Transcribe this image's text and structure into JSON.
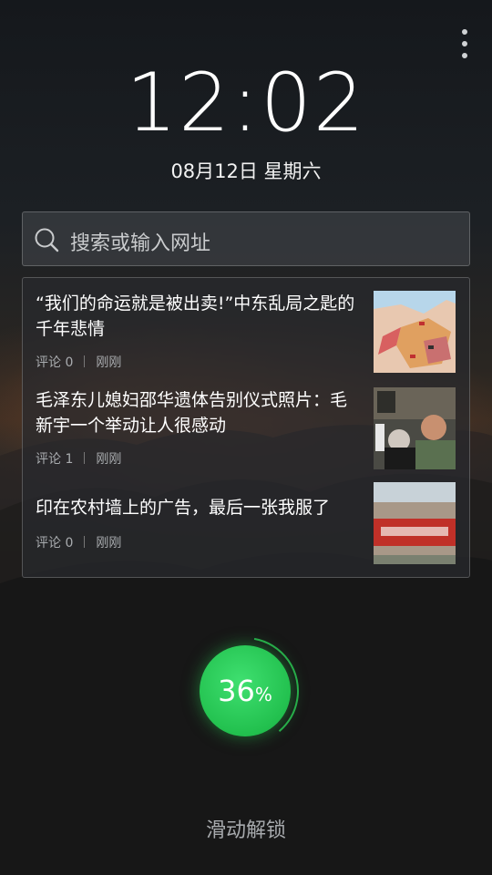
{
  "lockscreen": {
    "time": "12:02",
    "date": "08月12日 星期六",
    "menu_icon": "more-vert-icon",
    "search": {
      "placeholder": "搜索或输入网址",
      "icon": "search-icon"
    },
    "news": [
      {
        "title": "“我们的命运就是被出卖!”中东乱局之匙的千年悲情",
        "comment_label": "评论 0",
        "time": "刚刚",
        "thumb": "middle-east-map"
      },
      {
        "title": "毛泽东儿媳妇邵华遗体告别仪式照片：毛新宇一个举动让人很感动",
        "comment_label": "评论 1",
        "time": "刚刚",
        "thumb": "memorial-photo"
      },
      {
        "title": "印在农村墙上的广告，最后一张我服了",
        "comment_label": "评论 0",
        "time": "刚刚",
        "thumb": "rural-wall-ad"
      }
    ],
    "battery": {
      "value": 36,
      "unit": "%",
      "color": "#2bc552"
    },
    "unlock_hint": "滑动解锁"
  }
}
